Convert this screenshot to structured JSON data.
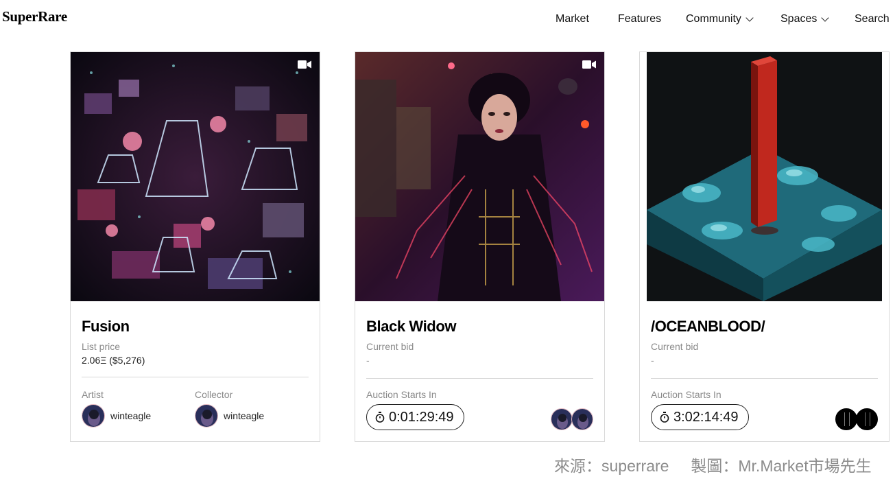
{
  "header": {
    "logo": "SuperRare",
    "nav": [
      {
        "label": "Market"
      },
      {
        "label": "Features"
      },
      {
        "label": "Community"
      },
      {
        "label": "Spaces"
      },
      {
        "label": "Search"
      }
    ]
  },
  "cards": [
    {
      "title": "Fusion",
      "price_label": "List price",
      "price_value": "2.06Ξ ($5,276)",
      "artist_label": "Artist",
      "artist_name": "winteagle",
      "collector_label": "Collector",
      "collector_name": "winteagle",
      "has_video": true
    },
    {
      "title": "Black Widow",
      "price_label": "Current bid",
      "price_value": "-",
      "auction_label": "Auction Starts In",
      "timer": "0:01:29:49",
      "has_video": true
    },
    {
      "title": "/OCEANBLOOD/",
      "price_label": "Current bid",
      "price_value": "-",
      "auction_label": "Auction Starts In",
      "timer": "3:02:14:49",
      "has_video": false
    }
  ],
  "icons": {
    "video": "video-camera-icon",
    "timer": "stopwatch-icon",
    "chevron": "chevron-down-icon"
  },
  "footer": {
    "source": "來源：superrare     製圖：Mr.Market市場先生"
  }
}
